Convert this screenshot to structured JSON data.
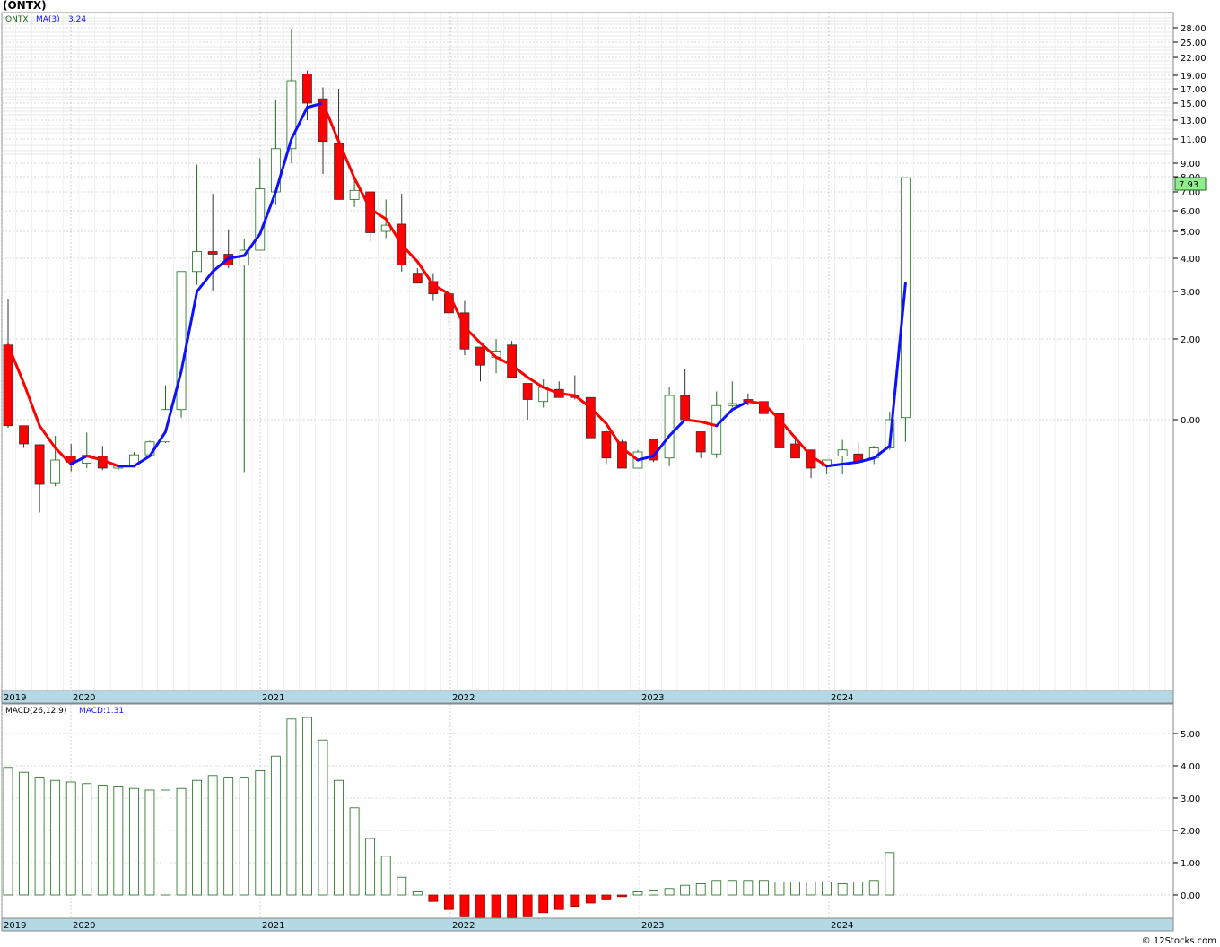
{
  "page": {
    "symbol_title": "(ONTX)",
    "credit": "© 12Stocks.com"
  },
  "price_panel": {
    "legend_symbol": "ONTX",
    "legend_ma": "MA(3)",
    "legend_ma_value": "3.24",
    "last_price_label": "7.93",
    "tick_labels": [
      "28.00",
      "25.00",
      "22.00",
      "19.00",
      "17.00",
      "15.00",
      "13.00",
      "11.00",
      "9.00",
      "8.00",
      "7.00",
      "6.00",
      "5.00",
      "4.00",
      "3.00",
      "2.00",
      "0.00"
    ]
  },
  "macd_panel": {
    "legend_name": "MACD(26,12,9)",
    "legend_value": "MACD:1.31",
    "tick_labels": [
      "5.00",
      "4.00",
      "3.00",
      "2.00",
      "1.00",
      "0.00"
    ]
  },
  "x_axis": {
    "year_labels": [
      "2019",
      "2020",
      "2021",
      "2022",
      "2023",
      "2024"
    ]
  },
  "colors": {
    "up": "#1a6b1a",
    "down": "#ff0000",
    "ma_up": "#1010ff",
    "ma_down": "#ff0000",
    "grid": "#b4b4b4",
    "axis_band": "#b4d8e4",
    "badge_bg": "#90ee90"
  },
  "chart_data": [
    {
      "type": "candlestick",
      "title": "(ONTX)",
      "interval": "monthly",
      "y_scale": "log-like (as printed)",
      "ma_period": 3,
      "year_labels": [
        "2019",
        "2020",
        "2021",
        "2022",
        "2023",
        "2024"
      ],
      "candles": [
        {
          "o": 1.85,
          "h": 2.85,
          "l": -0.2,
          "c": -0.15
        },
        {
          "o": -0.15,
          "h": -0.15,
          "l": -0.7,
          "c": -0.6
        },
        {
          "o": -0.62,
          "h": -0.66,
          "l": -2.3,
          "c": -1.6
        },
        {
          "o": -1.58,
          "h": -0.4,
          "l": -1.65,
          "c": -1.0
        },
        {
          "o": -0.9,
          "h": -0.6,
          "l": -1.28,
          "c": -1.05
        },
        {
          "o": -1.08,
          "h": -0.32,
          "l": -1.2,
          "c": -0.88
        },
        {
          "o": -0.9,
          "h": -0.65,
          "l": -1.25,
          "c": -1.2
        },
        {
          "o": -1.2,
          "h": -1.12,
          "l": -1.26,
          "c": -1.15
        },
        {
          "o": -1.12,
          "h": -0.8,
          "l": -1.18,
          "c": -0.87
        },
        {
          "o": -0.87,
          "h": -0.52,
          "l": -0.88,
          "c": -0.55
        },
        {
          "o": -0.55,
          "h": 0.85,
          "l": -0.58,
          "c": 0.25
        },
        {
          "o": 0.25,
          "h": 1.6,
          "l": 0.05,
          "c": 3.6
        },
        {
          "o": 3.6,
          "h": 8.9,
          "l": 3.2,
          "c": 4.25
        },
        {
          "o": 4.25,
          "h": 6.9,
          "l": 3.0,
          "c": 4.15
        },
        {
          "o": 4.15,
          "h": 5.1,
          "l": 3.7,
          "c": 3.8
        },
        {
          "o": 3.8,
          "h": 4.7,
          "l": -1.3,
          "c": 4.3
        },
        {
          "o": 4.3,
          "h": 9.4,
          "l": 5.8,
          "c": 7.2
        },
        {
          "o": 7.0,
          "h": 15.5,
          "l": 6.3,
          "c": 10.2
        },
        {
          "o": 10.2,
          "h": 27.8,
          "l": 9.0,
          "c": 18.2
        },
        {
          "o": 19.2,
          "h": 19.8,
          "l": 13.0,
          "c": 15.0
        },
        {
          "o": 15.6,
          "h": 17.2,
          "l": 8.2,
          "c": 10.8
        },
        {
          "o": 10.6,
          "h": 17.0,
          "l": 6.6,
          "c": 6.6
        },
        {
          "o": 6.6,
          "h": 7.8,
          "l": 6.2,
          "c": 7.1
        },
        {
          "o": 7.0,
          "h": 6.8,
          "l": 4.6,
          "c": 4.95
        },
        {
          "o": 5.0,
          "h": 6.6,
          "l": 4.75,
          "c": 5.3
        },
        {
          "o": 5.35,
          "h": 6.9,
          "l": 3.6,
          "c": 3.8
        },
        {
          "o": 3.55,
          "h": 3.7,
          "l": 3.3,
          "c": 3.25
        },
        {
          "o": 3.3,
          "h": 3.55,
          "l": 2.8,
          "c": 2.95
        },
        {
          "o": 2.95,
          "h": 3.0,
          "l": 2.3,
          "c": 2.55
        },
        {
          "o": 2.55,
          "h": 2.8,
          "l": 1.6,
          "c": 1.75
        },
        {
          "o": 1.8,
          "h": 1.5,
          "l": 0.95,
          "c": 1.35
        },
        {
          "o": 1.55,
          "h": 2.0,
          "l": 1.15,
          "c": 1.7
        },
        {
          "o": 1.85,
          "h": 1.95,
          "l": 1.05,
          "c": 1.05
        },
        {
          "o": 0.9,
          "h": 0.6,
          "l": 0.0,
          "c": 0.5
        },
        {
          "o": 0.45,
          "h": 1.0,
          "l": 0.3,
          "c": 0.8
        },
        {
          "o": 0.75,
          "h": 0.95,
          "l": 0.55,
          "c": 0.55
        },
        {
          "o": 0.6,
          "h": 1.1,
          "l": 0.5,
          "c": 0.55
        },
        {
          "o": 0.55,
          "h": 0.55,
          "l": -0.05,
          "c": -0.45
        },
        {
          "o": -0.3,
          "h": -0.25,
          "l": -1.1,
          "c": -0.95
        },
        {
          "o": -0.55,
          "h": -0.5,
          "l": -1.15,
          "c": -1.2
        },
        {
          "o": -1.2,
          "h": -0.75,
          "l": -0.9,
          "c": -0.8
        },
        {
          "o": -0.5,
          "h": -0.55,
          "l": -1.05,
          "c": -1.0
        },
        {
          "o": -0.95,
          "h": 0.8,
          "l": -1.15,
          "c": 0.6
        },
        {
          "o": 0.6,
          "h": 1.25,
          "l": 0.05,
          "c": 0.0
        },
        {
          "o": -0.3,
          "h": -0.3,
          "l": -0.95,
          "c": -0.8
        },
        {
          "o": -0.85,
          "h": 0.7,
          "l": -0.95,
          "c": 0.35
        },
        {
          "o": 0.35,
          "h": 0.95,
          "l": 0.3,
          "c": 0.4
        },
        {
          "o": 0.5,
          "h": 0.65,
          "l": 0.35,
          "c": 0.45
        },
        {
          "o": 0.45,
          "h": 0.35,
          "l": 0.25,
          "c": 0.15
        },
        {
          "o": 0.15,
          "h": 0.15,
          "l": -0.1,
          "c": -0.7
        },
        {
          "o": -0.6,
          "h": -0.45,
          "l": -0.9,
          "c": -0.95
        },
        {
          "o": -0.75,
          "h": -0.75,
          "l": -1.45,
          "c": -1.2
        },
        {
          "o": -1.15,
          "h": -1.05,
          "l": -1.35,
          "c": -1.0
        },
        {
          "o": -0.9,
          "h": -0.5,
          "l": -1.35,
          "c": -0.75
        },
        {
          "o": -0.85,
          "h": -0.55,
          "l": -1.0,
          "c": -1.05
        },
        {
          "o": -0.95,
          "h": -0.65,
          "l": -1.1,
          "c": -0.7
        },
        {
          "o": -0.7,
          "h": 0.2,
          "l": -0.75,
          "c": 0.0
        },
        {
          "o": 0.05,
          "h": 3.3,
          "l": -0.55,
          "c": 7.93
        }
      ],
      "ma": [
        1.85,
        0.9,
        -0.15,
        -0.7,
        -1.1,
        -0.9,
        -1.0,
        -1.15,
        -1.15,
        -0.9,
        -0.3,
        1.2,
        3.0,
        3.6,
        4.0,
        4.1,
        4.9,
        7.0,
        11.0,
        14.5,
        15.0,
        10.8,
        7.9,
        6.1,
        5.6,
        4.5,
        3.9,
        3.2,
        2.95,
        2.25,
        1.9,
        1.55,
        1.35,
        1.05,
        0.8,
        0.65,
        0.6,
        0.3,
        -0.1,
        -0.7,
        -1.0,
        -0.9,
        -0.4,
        0.0,
        -0.05,
        -0.15,
        0.25,
        0.45,
        0.4,
        0.0,
        -0.45,
        -0.9,
        -1.15,
        -1.1,
        -1.05,
        -0.95,
        -0.65,
        3.24
      ]
    },
    {
      "type": "bar",
      "title": "MACD(26,12,9)",
      "ylim": [
        -0.8,
        5.8
      ],
      "last_value": 1.31,
      "values": [
        3.95,
        3.8,
        3.65,
        3.55,
        3.5,
        3.45,
        3.4,
        3.35,
        3.3,
        3.25,
        3.25,
        3.3,
        3.55,
        3.7,
        3.65,
        3.65,
        3.85,
        4.3,
        5.45,
        5.5,
        4.8,
        3.55,
        2.7,
        1.75,
        1.2,
        0.55,
        0.1,
        -0.2,
        -0.45,
        -0.65,
        -0.75,
        -0.75,
        -0.7,
        -0.65,
        -0.55,
        -0.45,
        -0.35,
        -0.25,
        -0.15,
        -0.05,
        0.1,
        0.15,
        0.2,
        0.3,
        0.35,
        0.45,
        0.45,
        0.45,
        0.45,
        0.4,
        0.4,
        0.4,
        0.4,
        0.35,
        0.4,
        0.45,
        1.31
      ]
    }
  ]
}
